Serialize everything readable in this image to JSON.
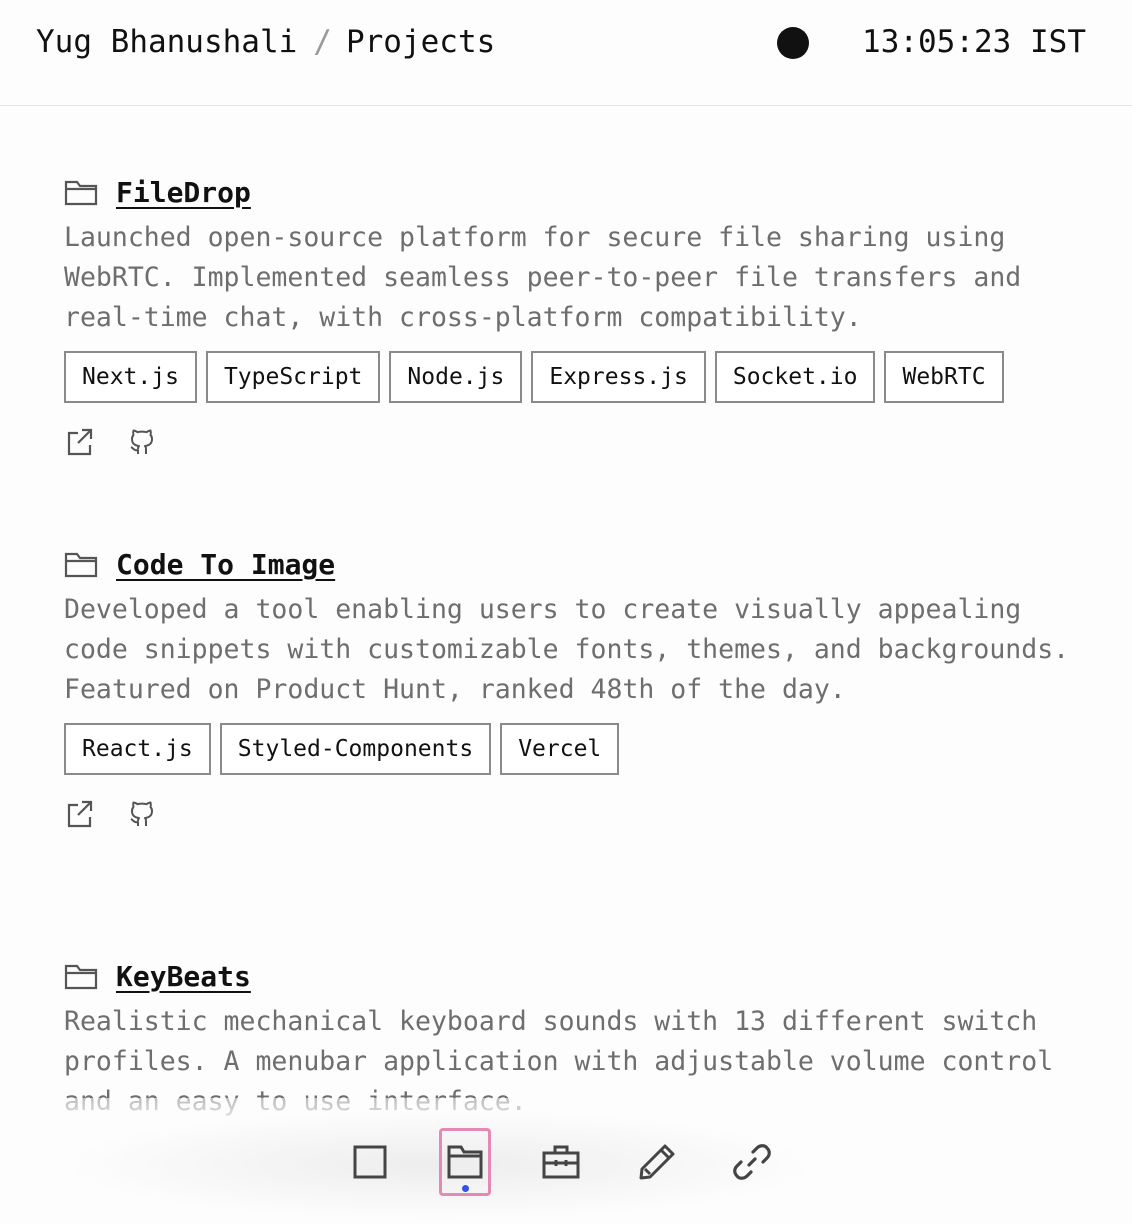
{
  "header": {
    "owner": "Yug Bhanushali",
    "separator": "/",
    "section": "Projects",
    "time": "13:05:23 IST"
  },
  "projects": [
    {
      "title": "FileDrop",
      "description": "Launched open-source platform for secure file sharing using WebRTC. Implemented seamless peer-to-peer file transfers and real-time chat, with cross-platform compatibility.",
      "tags": [
        "Next.js",
        "TypeScript",
        "Node.js",
        "Express.js",
        "Socket.io",
        "WebRTC"
      ],
      "links": [
        "external-link-icon",
        "github-icon"
      ]
    },
    {
      "title": "Code To Image",
      "description": "Developed a tool enabling users to create visually appealing code snippets with customizable fonts, themes, and backgrounds. Featured on Product Hunt, ranked 48th of the day.",
      "tags": [
        "React.js",
        "Styled-Components",
        "Vercel"
      ],
      "links": [
        "external-link-icon",
        "github-icon"
      ]
    },
    {
      "title": "KeyBeats",
      "description": "Realistic mechanical keyboard sounds with 13 different switch profiles. A menubar application with adjustable volume control and an easy to use interface.",
      "tags": [],
      "links": []
    }
  ],
  "dock": {
    "items": [
      "home-square-icon",
      "folder-icon",
      "briefcase-icon",
      "pencil-icon",
      "link-icon"
    ],
    "active_item": "folder-icon"
  },
  "colors": {
    "text": "#111111",
    "muted": "#6e6e6e",
    "tag_border": "#8a8a8a",
    "active_border": "#e28ab4",
    "active_dot": "#2f54eb"
  }
}
